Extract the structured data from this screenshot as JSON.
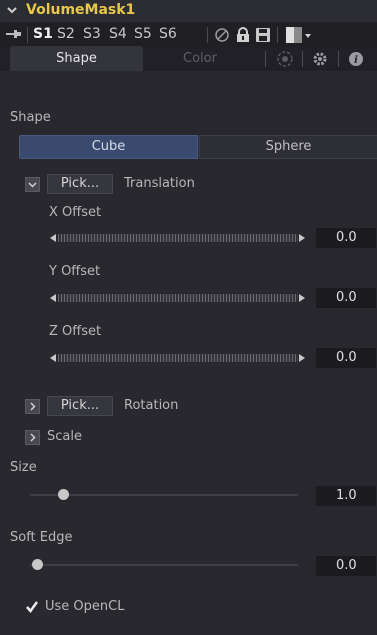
{
  "node": {
    "title": "VolumeMask1"
  },
  "toolbar": {
    "versions": [
      "S1",
      "S2",
      "S3",
      "S4",
      "S5",
      "S6"
    ],
    "active_version": "S1"
  },
  "tabs": [
    {
      "label": "Shape",
      "active": true
    },
    {
      "label": "Color",
      "active": false
    }
  ],
  "shape_section": {
    "label": "Shape",
    "options": [
      "Cube",
      "Sphere"
    ],
    "selected": "Cube"
  },
  "translation": {
    "pick_label": "Pick...",
    "label": "Translation",
    "x": {
      "label": "X Offset",
      "value": "0.0"
    },
    "y": {
      "label": "Y Offset",
      "value": "0.0"
    },
    "z": {
      "label": "Z Offset",
      "value": "0.0"
    }
  },
  "rotation": {
    "pick_label": "Pick...",
    "label": "Rotation"
  },
  "scale": {
    "label": "Scale"
  },
  "size": {
    "label": "Size",
    "value": "1.0"
  },
  "soft_edge": {
    "label": "Soft Edge",
    "value": "0.0"
  },
  "opencl": {
    "label": "Use OpenCL",
    "checked": true
  },
  "colors": {
    "title": "#e8c84a",
    "selected_segment": "#3a4a6e",
    "background": "#28282e"
  }
}
